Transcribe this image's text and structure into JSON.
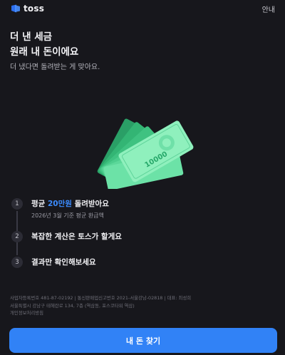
{
  "header": {
    "logo_text": "toss",
    "logo_icon": "toss-logo-icon",
    "guide_label": "안내"
  },
  "hero": {
    "title_line1": "더 낸 세금",
    "title_line2": "원래 내 돈이에요",
    "subtitle": "더 냈다면 돌려받는 게 맞아요."
  },
  "illustration": {
    "icon": "money-bills-illustration",
    "bill_value": "10000",
    "colors": {
      "bill_light": "#8ff0bd",
      "bill_mid": "#4fd28f",
      "bill_dark": "#27a86a"
    }
  },
  "steps": [
    {
      "number": "1",
      "title_prefix": "평균 ",
      "title_highlight": "20만원",
      "title_suffix": " 돌려받아요",
      "description": "2026년 3월 기준 평균 환급액"
    },
    {
      "number": "2",
      "title": "복잡한 계산은 토스가 할게요"
    },
    {
      "number": "3",
      "title": "결과만 확인해보세요"
    }
  ],
  "footer": {
    "line1": "사업자등록번호 481-87-02192 | 통신판매업신고번호 2021-서울강남-02818 | 대표: 최성희",
    "line2": "서울특별시 강남구 테헤란로 134, 7층 (역삼동, 포스코타워 역삼)",
    "line3": "개인정보처리방침"
  },
  "cta": {
    "label": "내 돈 찾기"
  },
  "colors": {
    "accent": "#3182f6",
    "highlight": "#3c8cff",
    "background": "#17171c"
  }
}
